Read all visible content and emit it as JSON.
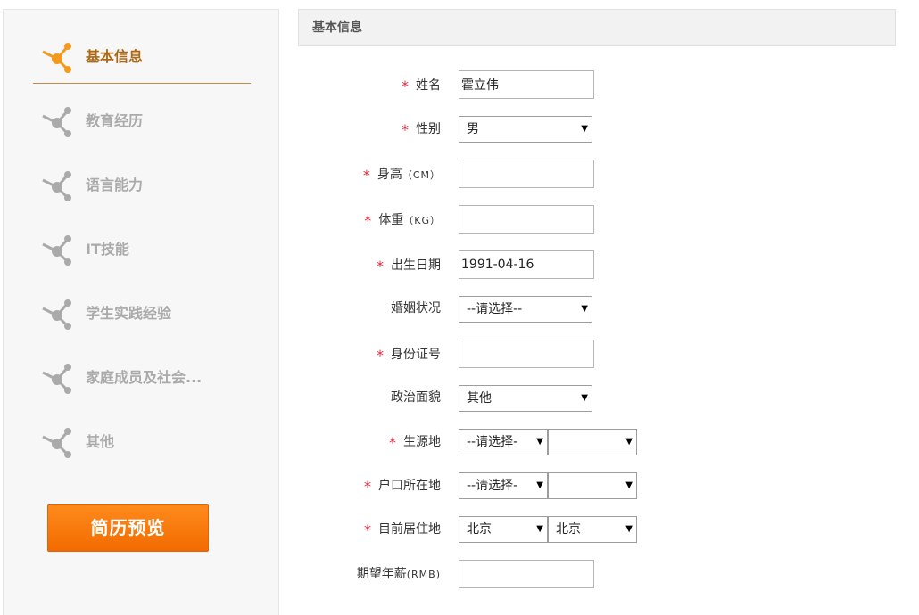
{
  "sidebar": {
    "items": [
      {
        "label": "基本信息",
        "active": true
      },
      {
        "label": "教育经历"
      },
      {
        "label": "语言能力"
      },
      {
        "label": "IT技能"
      },
      {
        "label": "学生实践经验"
      },
      {
        "label": "家庭成员及社会..."
      },
      {
        "label": "其他"
      }
    ],
    "preview_button": "简历预览",
    "accent": "#f39a1e",
    "inactive_icon": "#aaaaaa"
  },
  "section": {
    "title": "基本信息"
  },
  "form": {
    "name": {
      "label": "姓名",
      "value": "霍立伟"
    },
    "gender": {
      "label": "性别",
      "value": "男"
    },
    "height": {
      "label": "身高",
      "unit": "（CM）",
      "value": ""
    },
    "weight": {
      "label": "体重",
      "unit": "（KG）",
      "value": ""
    },
    "birthdate": {
      "label": "出生日期",
      "value": "1991-04-16"
    },
    "marital": {
      "label": "婚姻状况",
      "value": "--请选择--"
    },
    "id_number": {
      "label": "身份证号",
      "value": ""
    },
    "political": {
      "label": "政治面貌",
      "value": "其他"
    },
    "origin": {
      "label": "生源地",
      "value1": "--请选择-",
      "value2": ""
    },
    "hukou": {
      "label": "户口所在地",
      "value1": "--请选择-",
      "value2": ""
    },
    "residence": {
      "label": "目前居住地",
      "value1": "北京",
      "value2": "北京"
    },
    "salary": {
      "label": "期望年薪",
      "unit": "(RMB)",
      "value": ""
    },
    "required_mark": "*",
    "arrow": "▼"
  }
}
